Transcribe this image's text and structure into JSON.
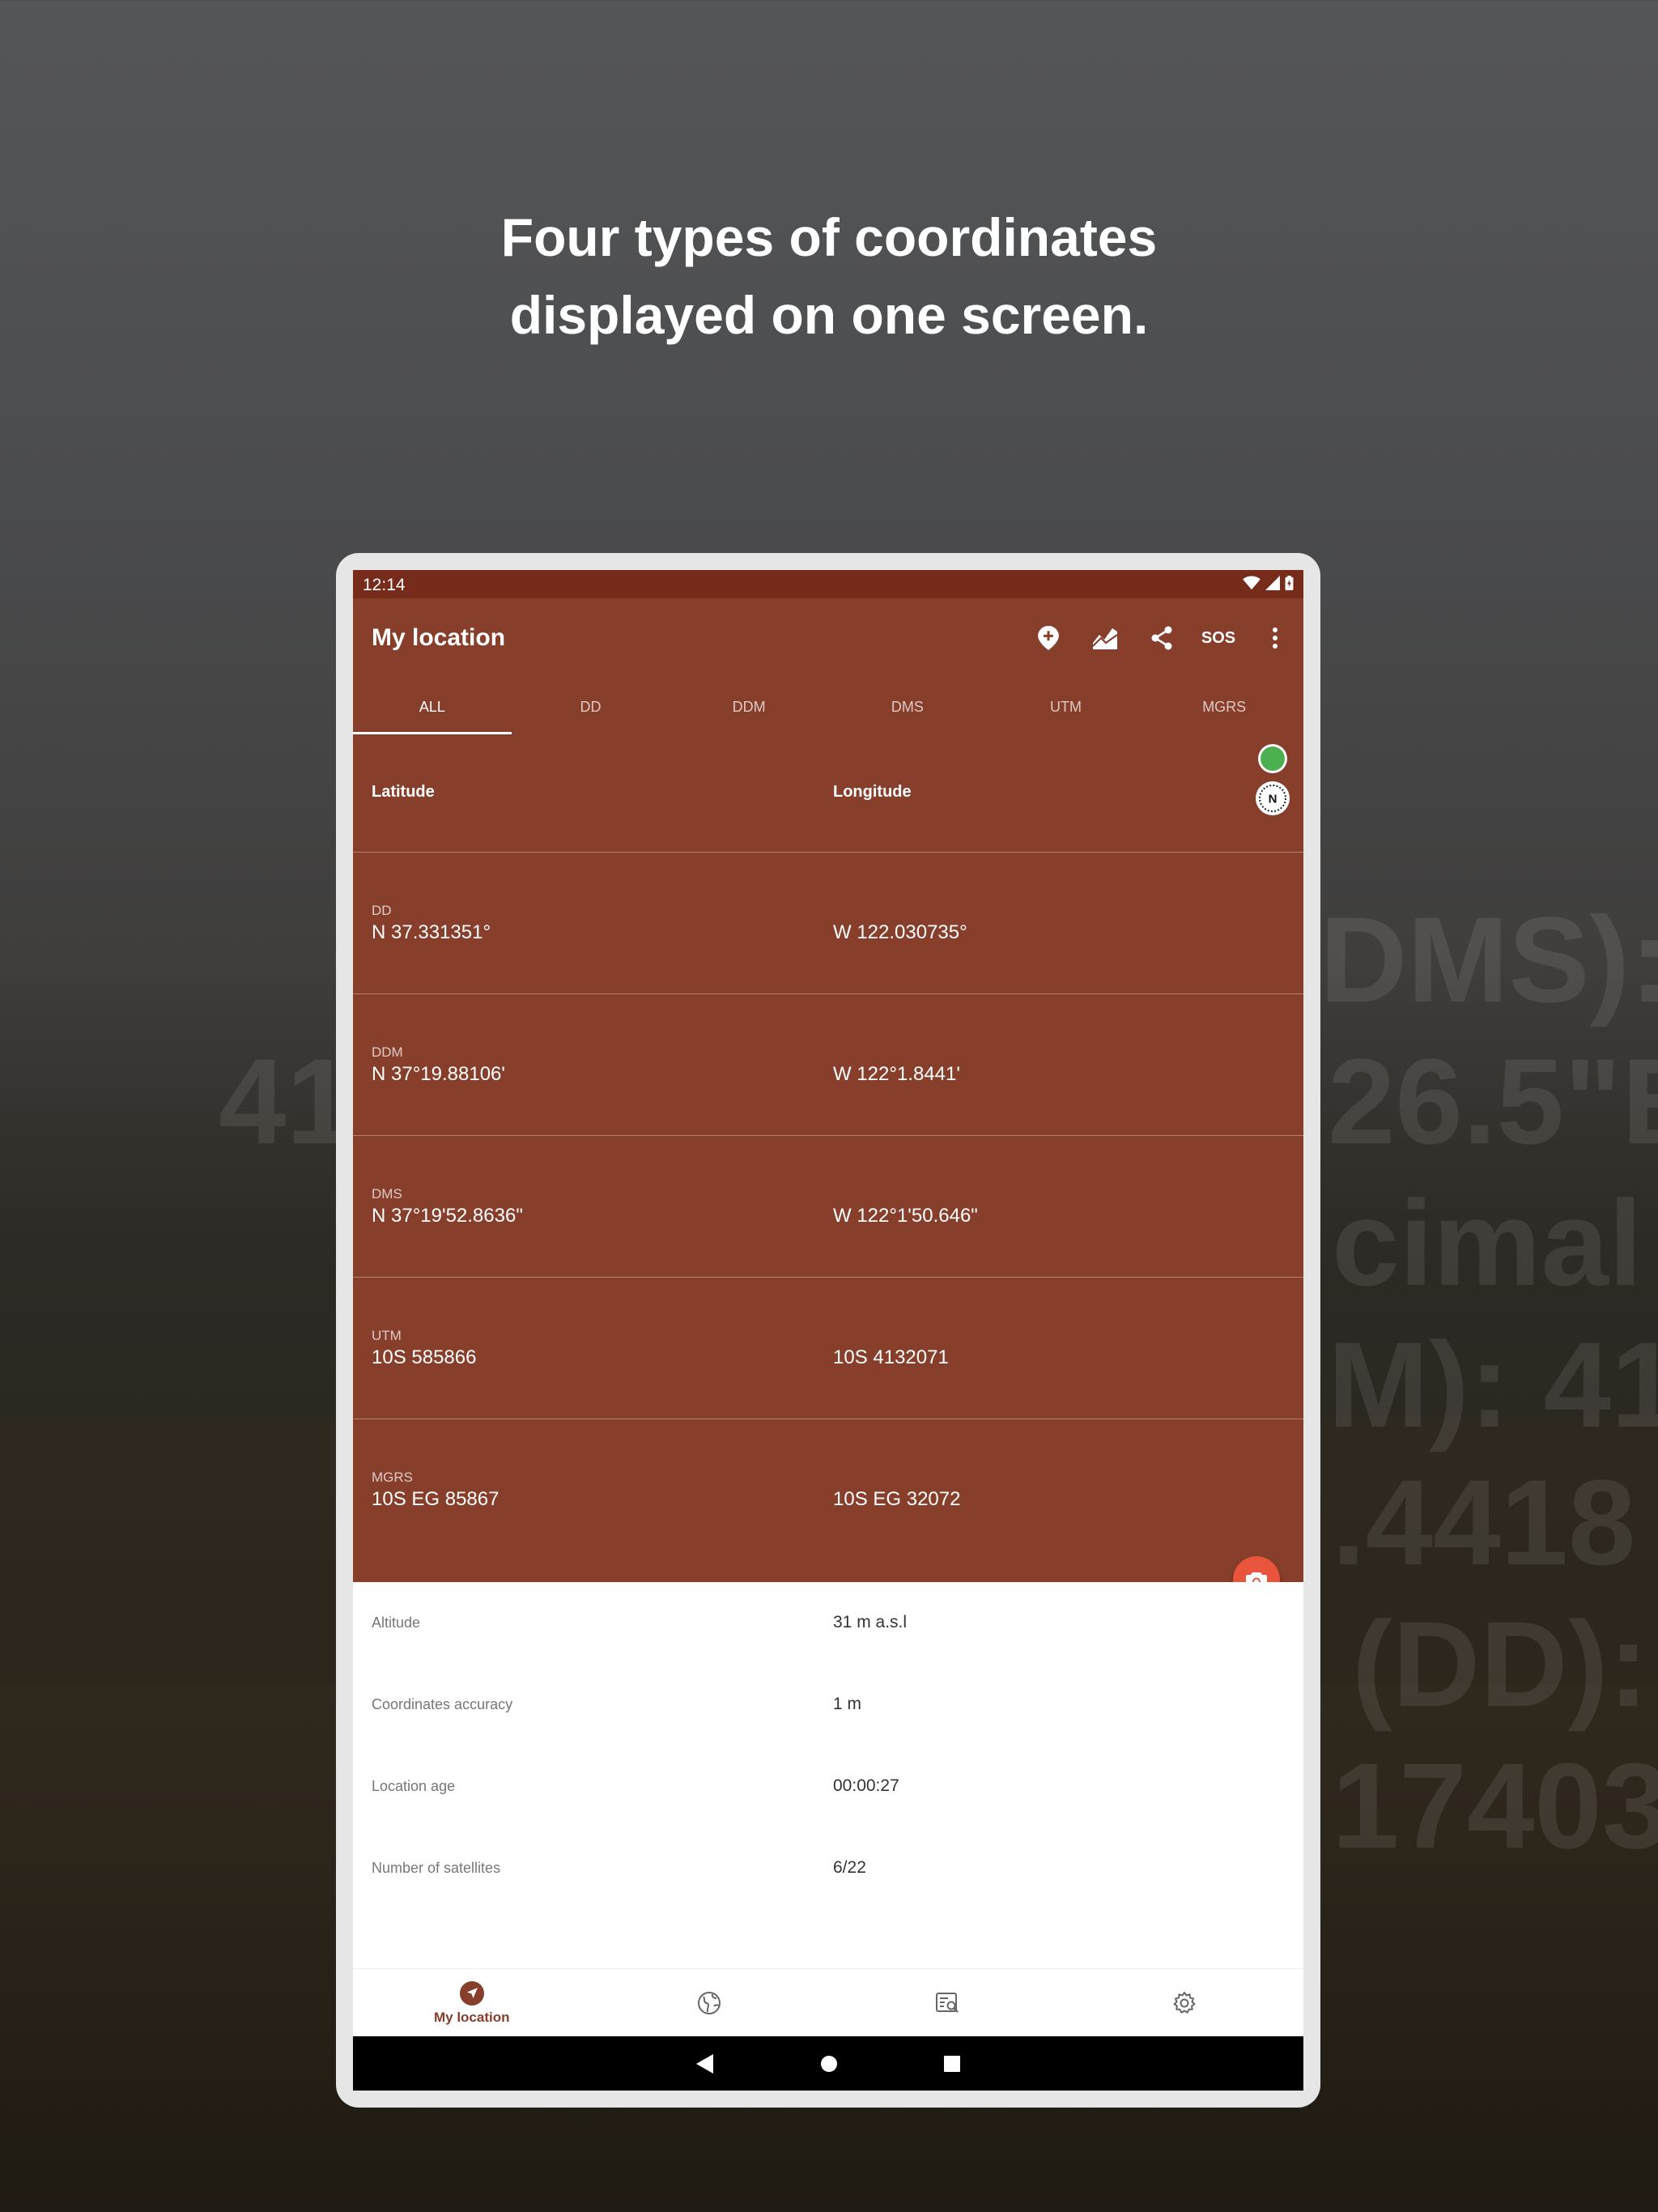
{
  "headline": {
    "line1": "Four types of coordinates",
    "line2": "displayed on one screen."
  },
  "background_text": [
    "DMS):",
    "41",
    "26.5\"E",
    "cimal",
    "M): 41",
    ".4418",
    "(DD):",
    "17403"
  ],
  "status_bar": {
    "time": "12:14"
  },
  "app_bar": {
    "title": "My location",
    "actions": [
      "add-location-icon",
      "elevation-chart-icon",
      "share-icon",
      "SOS",
      "more-vert-icon"
    ],
    "sos_label": "SOS"
  },
  "tabs": [
    {
      "label": "ALL",
      "active": true
    },
    {
      "label": "DD",
      "active": false
    },
    {
      "label": "DDM",
      "active": false
    },
    {
      "label": "DMS",
      "active": false
    },
    {
      "label": "UTM",
      "active": false
    },
    {
      "label": "MGRS",
      "active": false
    }
  ],
  "coords": {
    "latitude_label": "Latitude",
    "longitude_label": "Longitude",
    "compass_label": "N",
    "rows": [
      {
        "type": "DD",
        "lat": "N 37.331351°",
        "lon": "W 122.030735°"
      },
      {
        "type": "DDM",
        "lat": "N 37°19.88106'",
        "lon": "W 122°1.8441'"
      },
      {
        "type": "DMS",
        "lat": "N 37°19'52.8636\"",
        "lon": "W 122°1'50.646\""
      },
      {
        "type": "UTM",
        "lat": "10S 585866",
        "lon": "10S 4132071"
      },
      {
        "type": "MGRS",
        "lat": "10S EG 85867",
        "lon": "10S EG 32072"
      }
    ]
  },
  "info": [
    {
      "key": "Altitude",
      "value": "31 m a.s.l"
    },
    {
      "key": "Coordinates accuracy",
      "value": "1 m"
    },
    {
      "key": "Location age",
      "value": "00:00:27"
    },
    {
      "key": "Number of satellites",
      "value": "6/22"
    }
  ],
  "bottom_nav": {
    "items": [
      {
        "icon": "navigation-arrow-icon",
        "label": "My location",
        "active": true
      },
      {
        "icon": "globe-icon",
        "label": "",
        "active": false
      },
      {
        "icon": "map-search-icon",
        "label": "",
        "active": false
      },
      {
        "icon": "gear-icon",
        "label": "",
        "active": false
      }
    ]
  },
  "colors": {
    "app_primary": "#873f2b",
    "status_bar": "#772b1a",
    "fab": "#e8553a",
    "gps_ok": "#4caf50"
  }
}
